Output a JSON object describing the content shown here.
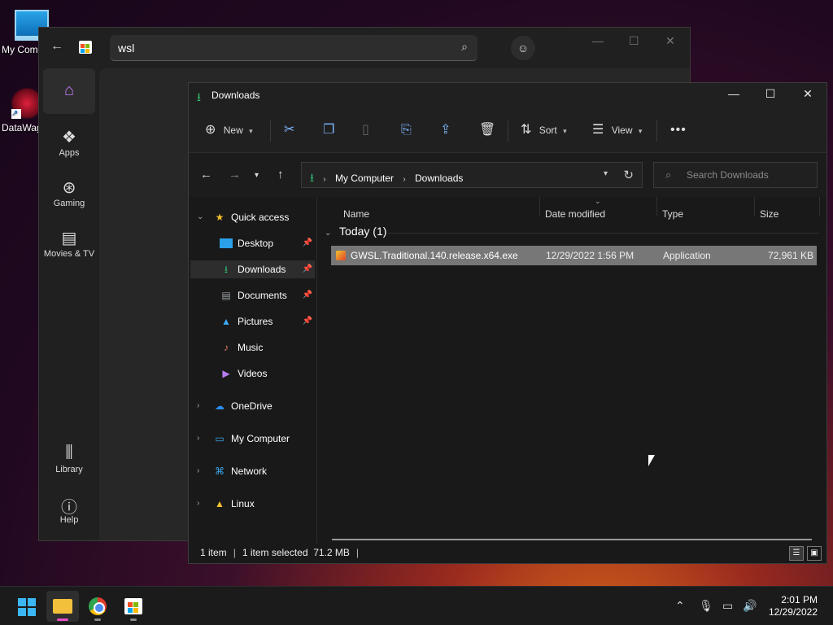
{
  "desktop": {
    "icons": [
      {
        "label": "My Com"
      },
      {
        "label": "DataWag"
      }
    ]
  },
  "store": {
    "search_value": "wsl",
    "nav": [
      {
        "label": "Apps"
      },
      {
        "label": "Gaming"
      },
      {
        "label": "Movies & TV"
      },
      {
        "label": "Library"
      },
      {
        "label": "Help"
      }
    ]
  },
  "explorer": {
    "title": "Downloads",
    "toolbar": {
      "new": "New",
      "sort": "Sort",
      "view": "View"
    },
    "address": {
      "crumbs": [
        "My Computer",
        "Downloads"
      ],
      "search_placeholder": "Search Downloads"
    },
    "sidebar": {
      "quick_access": "Quick access",
      "items": [
        {
          "label": "Desktop"
        },
        {
          "label": "Downloads"
        },
        {
          "label": "Documents"
        },
        {
          "label": "Pictures"
        },
        {
          "label": "Music"
        },
        {
          "label": "Videos"
        }
      ],
      "roots": [
        {
          "label": "OneDrive"
        },
        {
          "label": "My Computer"
        },
        {
          "label": "Network"
        },
        {
          "label": "Linux"
        }
      ]
    },
    "columns": [
      "Name",
      "Date modified",
      "Type",
      "Size"
    ],
    "group": "Today (1)",
    "files": [
      {
        "name": "GWSL.Traditional.140.release.x64.exe",
        "date": "12/29/2022 1:56 PM",
        "type": "Application",
        "size": "72,961 KB"
      }
    ],
    "status": {
      "count": "1 item",
      "selected": "1 item selected",
      "size": "71.2 MB"
    }
  },
  "taskbar": {
    "time": "2:01 PM",
    "date": "12/29/2022"
  },
  "colors": {
    "accent_download": "#2fbf71",
    "store_home": "#c77dff",
    "active_indicator": "#e94fc6"
  }
}
